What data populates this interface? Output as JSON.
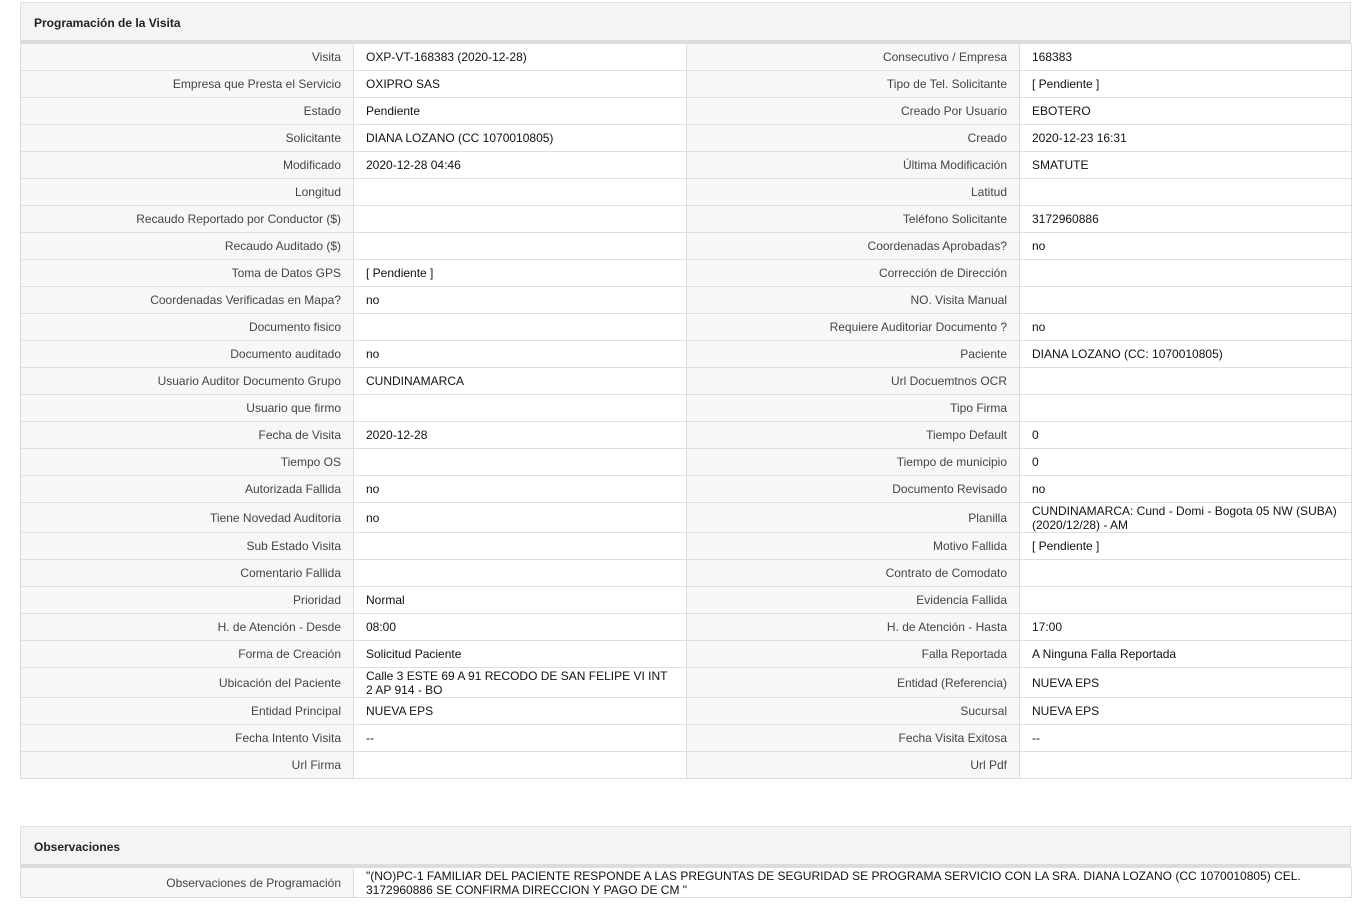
{
  "programacion": {
    "title": "Programación de la Visita",
    "rows": [
      {
        "l1": "Visita",
        "v1": "OXP-VT-168383 (2020-12-28)",
        "l2": "Consecutivo / Empresa",
        "v2": "168383"
      },
      {
        "l1": "Empresa que Presta el Servicio",
        "v1": "OXIPRO SAS",
        "l2": "Tipo de Tel. Solicitante",
        "v2": "[ Pendiente ]"
      },
      {
        "l1": "Estado",
        "v1": "Pendiente",
        "l2": "Creado Por Usuario",
        "v2": "EBOTERO"
      },
      {
        "l1": "Solicitante",
        "v1": "DIANA LOZANO (CC 1070010805)",
        "l2": "Creado",
        "v2": "2020-12-23 16:31"
      },
      {
        "l1": "Modificado",
        "v1": "2020-12-28 04:46",
        "l2": "Última Modificación",
        "v2": " SMATUTE"
      },
      {
        "l1": "Longitud",
        "v1": "",
        "l2": "Latitud",
        "v2": ""
      },
      {
        "l1": "Recaudo Reportado por Conductor ($)",
        "v1": "",
        "l2": "Teléfono Solicitante",
        "v2": "3172960886"
      },
      {
        "l1": "Recaudo Auditado ($)",
        "v1": "",
        "l2": "Coordenadas Aprobadas?",
        "v2": " no"
      },
      {
        "l1": "Toma de Datos GPS",
        "v1": "[ Pendiente ]",
        "l2": "Corrección de Dirección",
        "v2": ""
      },
      {
        "l1": "Coordenadas Verificadas en Mapa?",
        "v1": " no",
        "l2": "NO. Visita Manual",
        "v2": ""
      },
      {
        "l1": "Documento fisico",
        "v1": "",
        "l2": "Requiere Auditoriar Documento ?",
        "v2": " no"
      },
      {
        "l1": "Documento auditado",
        "v1": " no",
        "l2": "Paciente",
        "v2": "DIANA LOZANO (CC: 1070010805)"
      },
      {
        "l1": "Usuario Auditor Documento Grupo",
        "v1": "CUNDINAMARCA",
        "l2": "Url Docuemtnos OCR",
        "v2": ""
      },
      {
        "l1": "Usuario que firmo",
        "v1": "",
        "l2": "Tipo Firma",
        "v2": ""
      },
      {
        "l1": "Fecha de Visita",
        "v1": " 2020-12-28",
        "l2": "Tiempo Default",
        "v2": "0"
      },
      {
        "l1": "Tiempo OS",
        "v1": "",
        "l2": "Tiempo de municipio",
        "v2": "0"
      },
      {
        "l1": "Autorizada Fallida",
        "v1": " no",
        "l2": "Documento Revisado",
        "v2": " no"
      },
      {
        "l1": "Tiene Novedad Auditoria",
        "v1": " no",
        "l2": "Planilla",
        "v2": "CUNDINAMARCA: Cund - Domi - Bogota 05 NW (SUBA) (2020/12/28) - AM"
      },
      {
        "l1": "Sub Estado Visita",
        "v1": "",
        "l2": "Motivo Fallida",
        "v2": "[ Pendiente ]"
      },
      {
        "l1": "Comentario Fallida",
        "v1": "",
        "l2": "Contrato de Comodato",
        "v2": ""
      },
      {
        "l1": "Prioridad",
        "v1": "Normal",
        "l2": "Evidencia Fallida",
        "v2": ""
      },
      {
        "l1": "H. de Atención - Desde",
        "v1": "08:00",
        "l2": "H. de Atención - Hasta",
        "v2": "17:00"
      },
      {
        "l1": "Forma de Creación",
        "v1": "Solicitud Paciente",
        "l2": "Falla Reportada",
        "v2": "A Ninguna Falla Reportada"
      },
      {
        "l1": "Ubicación del Paciente",
        "v1": "Calle 3 ESTE 69 A 91 RECODO DE SAN FELIPE VI INT 2 AP 914 - BO",
        "l2": "Entidad (Referencia)",
        "v2": "NUEVA EPS"
      },
      {
        "l1": "Entidad Principal",
        "v1": "NUEVA EPS",
        "l2": "Sucursal",
        "v2": "NUEVA EPS"
      },
      {
        "l1": "Fecha Intento Visita",
        "v1": "--",
        "l2": "Fecha Visita Exitosa",
        "v2": "--"
      },
      {
        "l1": "Url Firma",
        "v1": "",
        "l2": "Url Pdf",
        "v2": ""
      }
    ]
  },
  "observaciones": {
    "title": "Observaciones",
    "label": "Observaciones de Programación",
    "value": " \"(NO)PC-1 FAMILIAR DEL PACIENTE RESPONDE A LAS PREGUNTAS DE SEGURIDAD SE PROGRAMA SERVICIO CON LA SRA. DIANA LOZANO (CC 1070010805) CEL. 3172960886 SE CONFIRMA DIRECCION Y PAGO DE CM \""
  }
}
